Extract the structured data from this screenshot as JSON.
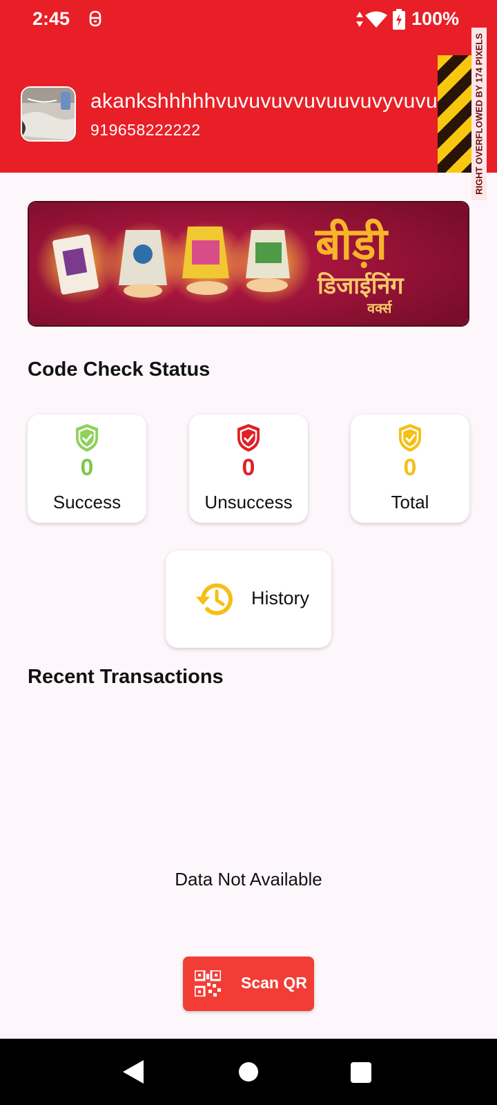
{
  "status_bar": {
    "time": "2:45",
    "battery_pct": "100%"
  },
  "profile": {
    "name": "akankshhhhhvuvuvuvvuvuuvuvyvuvuvhv",
    "phone": "919658222222"
  },
  "debug": {
    "overflow_text": "RIGHT OVERFLOWED BY 174 PIXELS"
  },
  "banner": {
    "title_hi": "बीड़ी",
    "subtitle_hi": "डिजाईनिंग",
    "tag_hi": "वर्क्स"
  },
  "code_check": {
    "title": "Code Check Status",
    "success": {
      "count": "0",
      "label": "Success",
      "color": "#7ec84a"
    },
    "unsuccess": {
      "count": "0",
      "label": "Unsuccess",
      "color": "#e02026"
    },
    "total": {
      "count": "0",
      "label": "Total",
      "color": "#f5bf17"
    }
  },
  "history": {
    "label": "History"
  },
  "recent": {
    "title": "Recent Transactions",
    "empty_message": "Data Not Available"
  },
  "scan": {
    "label": "Scan QR"
  },
  "colors": {
    "header_bg": "#e81f26",
    "scan_btn": "#f23d36",
    "accent_yellow": "#f5bf17"
  }
}
